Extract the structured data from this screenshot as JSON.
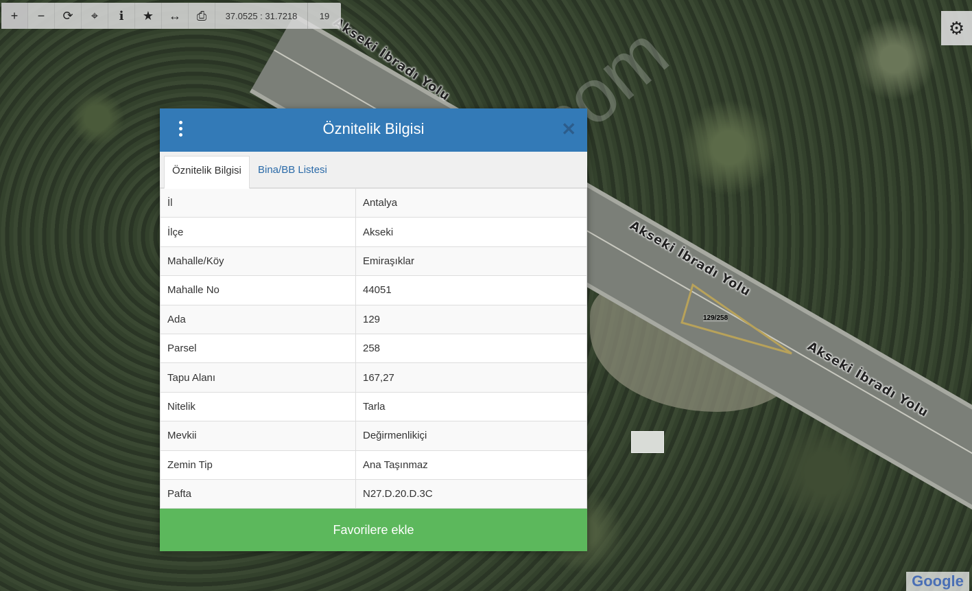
{
  "toolbar": {
    "buttons": [
      {
        "name": "zoom-in",
        "glyph": "+"
      },
      {
        "name": "zoom-out",
        "glyph": "−"
      },
      {
        "name": "refresh",
        "glyph": "⟳"
      },
      {
        "name": "locate",
        "glyph": "⌖"
      },
      {
        "name": "info",
        "glyph": "i"
      },
      {
        "name": "favorite",
        "glyph": "★"
      },
      {
        "name": "measure",
        "glyph": "↔"
      },
      {
        "name": "print",
        "glyph": "⎙"
      }
    ],
    "coordinates": "37.0525 : 31.7218",
    "zoom_level": "19"
  },
  "map": {
    "road_labels": [
      "Akseki İbradı Yolu",
      "Akseki İbradı Yolu",
      "Akseki İbradı Yolu"
    ],
    "parcel_label": "129/258",
    "watermark": "emlakjet.com",
    "provider_logo": "Google"
  },
  "modal": {
    "title": "Öznitelik Bilgisi",
    "tabs": [
      "Öznitelik Bilgisi",
      "Bina/BB Listesi"
    ],
    "rows": [
      {
        "key": "İl",
        "value": "Antalya"
      },
      {
        "key": "İlçe",
        "value": "Akseki"
      },
      {
        "key": "Mahalle/Köy",
        "value": "Emiraşıklar"
      },
      {
        "key": "Mahalle No",
        "value": "44051"
      },
      {
        "key": "Ada",
        "value": "129"
      },
      {
        "key": "Parsel",
        "value": "258"
      },
      {
        "key": "Tapu Alanı",
        "value": "167,27"
      },
      {
        "key": "Nitelik",
        "value": "Tarla"
      },
      {
        "key": "Mevkii",
        "value": "Değirmenlikiçi"
      },
      {
        "key": "Zemin Tip",
        "value": "Ana Taşınmaz"
      },
      {
        "key": "Pafta",
        "value": "N27.D.20.D.3C"
      }
    ],
    "favorite_button": "Favorilere ekle"
  },
  "colors": {
    "header": "#337ab7",
    "favorite_button": "#5cb85c",
    "parcel_outline": "#b8a25a"
  }
}
